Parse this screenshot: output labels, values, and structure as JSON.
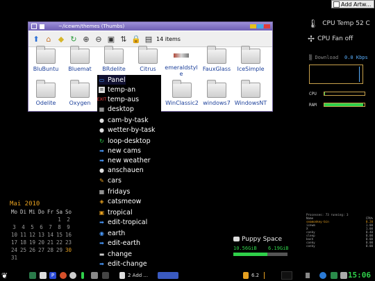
{
  "add_artwork_button": "Add Artw...",
  "window": {
    "title": "~/icewm/themes (Thumbs)",
    "items_count": "14 items",
    "files": [
      {
        "name": "BluBuntu"
      },
      {
        "name": "Bluemat"
      },
      {
        "name": "BRdelite"
      },
      {
        "name": "Citrus"
      },
      {
        "name": "emeraldstyle"
      },
      {
        "name": "FauxGlass"
      },
      {
        "name": "IceSimple"
      },
      {
        "name": "Odelite"
      },
      {
        "name": "Oxygen"
      },
      {
        "name": "WinClassic2"
      },
      {
        "name": "windows7"
      },
      {
        "name": "WindowsNT"
      }
    ]
  },
  "menu": {
    "items": [
      {
        "label": "Panel",
        "icon": "panel-icon"
      },
      {
        "label": "temp-an",
        "icon": "document-icon"
      },
      {
        "label": "temp-aus",
        "icon": "exit-icon"
      },
      {
        "label": "desktop",
        "icon": "grid-icon"
      },
      {
        "label": "cam-by-task",
        "icon": "cloud-icon"
      },
      {
        "label": "wetter-by-task",
        "icon": "cloud-icon"
      },
      {
        "label": "loop-desktop",
        "icon": "refresh-icon"
      },
      {
        "label": "new cams",
        "icon": "arrow-right-icon"
      },
      {
        "label": "new weather",
        "icon": "arrow-right-icon"
      },
      {
        "label": "anschauen",
        "icon": "cloud-icon"
      },
      {
        "label": "cars",
        "icon": "brush-icon"
      },
      {
        "label": "fridays",
        "icon": "grid-icon"
      },
      {
        "label": "catsmeow",
        "icon": "paw-icon"
      },
      {
        "label": "tropical",
        "icon": "image-icon"
      },
      {
        "label": "edit-tropical",
        "icon": "arrow-right-icon"
      },
      {
        "label": "earth",
        "icon": "globe-icon"
      },
      {
        "label": "edit-earth",
        "icon": "arrow-right-icon"
      },
      {
        "label": "change",
        "icon": "image-icon"
      },
      {
        "label": "edit-change",
        "icon": "arrow-right-icon"
      }
    ]
  },
  "sensors": {
    "cpu_temp": "CPU Temp 52 C",
    "cpu_fan": "CPU Fan off"
  },
  "network": {
    "download_label": "Download",
    "download_value": "0.0 Kbps"
  },
  "meters": {
    "cpu_label": "CPU",
    "cpu_fraction": 0.02,
    "ram_label": "RAM",
    "ram_fraction": 0.96
  },
  "calendar": {
    "month": "Mai  2010",
    "weekdays": [
      "Mo",
      "Di",
      "Mi",
      "Do",
      "Fr",
      "Sa",
      "So"
    ],
    "rows": [
      [
        "",
        "",
        "",
        "",
        "",
        "1",
        "2"
      ],
      [
        "3",
        "4",
        "5",
        "6",
        "7",
        "8",
        "9"
      ],
      [
        "10",
        "11",
        "12",
        "13",
        "14",
        "15",
        "16"
      ],
      [
        "17",
        "18",
        "19",
        "20",
        "21",
        "22",
        "23"
      ],
      [
        "24",
        "25",
        "26",
        "27",
        "28",
        "29",
        "30"
      ],
      [
        "31",
        "",
        "",
        "",
        "",
        "",
        ""
      ]
    ],
    "today": "30"
  },
  "puppy_space": {
    "title": "Puppy Space",
    "used": "10.56GiB",
    "free": "6.19GiB",
    "used_fraction": 0.63
  },
  "processes": {
    "summary": "Processes: 73   running: 3",
    "header": [
      "Name",
      "CPU%"
    ],
    "rows": [
      [
        "seamonkey-bin",
        "0.20"
      ],
      [
        "icewm",
        "1.00"
      ],
      [
        "X",
        "1.00"
      ],
      [
        "conky",
        "0.40"
      ],
      [
        "sleep",
        "0.00"
      ],
      [
        "bash",
        "0.00"
      ],
      [
        "conky",
        "0.00"
      ],
      [
        "conky",
        "0.00"
      ]
    ]
  },
  "taskbar": {
    "task_label": "2  Add ...",
    "tray_value": "6.2",
    "clock": "15:06"
  }
}
